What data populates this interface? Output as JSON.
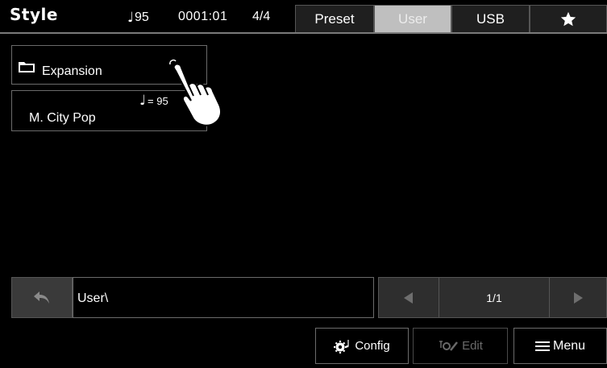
{
  "header": {
    "title": "Style",
    "tempo_note": "♩",
    "tempo_value": "95",
    "time": "0001:01",
    "time_signature": "4/4"
  },
  "tabs": [
    {
      "label": "Preset",
      "active": false
    },
    {
      "label": "User",
      "active": true
    },
    {
      "label": "USB",
      "active": false
    },
    {
      "label": "",
      "icon": "star-icon",
      "active": false
    }
  ],
  "list": {
    "folder": {
      "label": "Expansion",
      "icon": "folder-icon"
    },
    "style": {
      "tempo_note": "♩",
      "tempo_text": "= 95",
      "name": "M. City Pop"
    }
  },
  "pathbar": {
    "back_icon": "back-arrow-icon",
    "path": "User\\",
    "page": "1/1",
    "prev_icon": "left-triangle-icon",
    "next_icon": "right-triangle-icon"
  },
  "buttons": {
    "config": {
      "label": "Config",
      "icon": "gear-note-icon"
    },
    "edit": {
      "label": "Edit",
      "icon": "edit-icon",
      "enabled": false
    },
    "menu": {
      "label": "Menu",
      "icon": "hamburger-icon"
    }
  },
  "colors": {
    "background": "#000000",
    "active_tab": "#bfbfbf",
    "disabled_text": "#6a6a6a"
  }
}
